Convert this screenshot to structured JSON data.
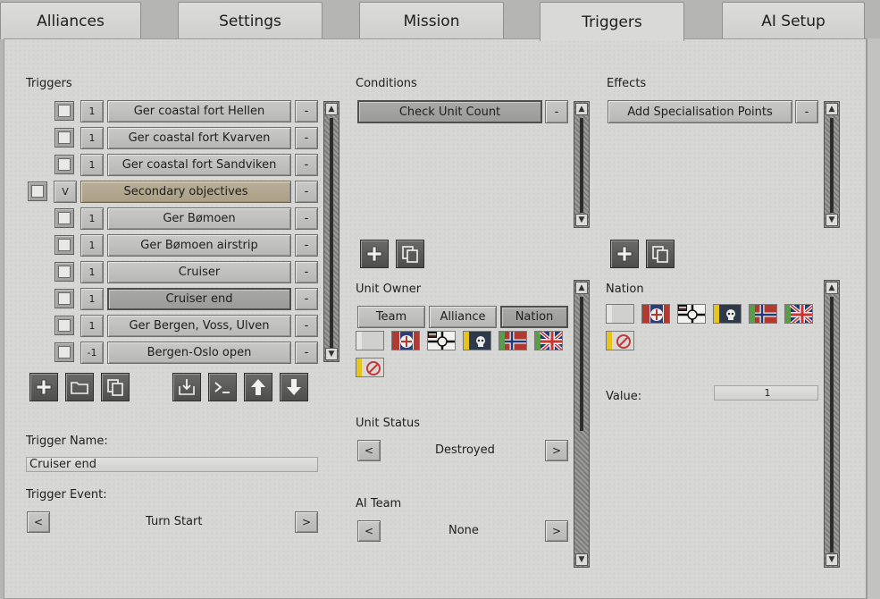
{
  "tabs": [
    "Alliances",
    "Settings",
    "Mission",
    "Triggers",
    "AI Setup"
  ],
  "triggers": {
    "title": "Triggers",
    "rows": [
      {
        "num": "1",
        "name": "Ger coastal fort Hellen",
        "remove": "-"
      },
      {
        "num": "1",
        "name": "Ger coastal fort Kvarven",
        "remove": "-"
      },
      {
        "num": "1",
        "name": "Ger coastal fort Sandviken",
        "remove": "-"
      },
      {
        "num": "V",
        "name": "Secondary objectives",
        "remove": "-"
      },
      {
        "num": "1",
        "name": "Ger Bømoen",
        "remove": "-"
      },
      {
        "num": "1",
        "name": "Ger Bømoen airstrip",
        "remove": "-"
      },
      {
        "num": "1",
        "name": "Cruiser",
        "remove": "-"
      },
      {
        "num": "1",
        "name": "Cruiser end",
        "remove": "-"
      },
      {
        "num": "1",
        "name": "Ger Bergen, Voss, Ulven",
        "remove": "-"
      },
      {
        "num": "-1",
        "name": "Bergen-Oslo open",
        "remove": "-"
      }
    ],
    "name_label": "Trigger Name:",
    "name_value": "Cruiser end",
    "event_label": "Trigger Event:",
    "event_value": "Turn Start",
    "prev": "<",
    "next": ">"
  },
  "conditions": {
    "title": "Conditions",
    "items": [
      {
        "name": "Check Unit Count",
        "remove": "-"
      }
    ],
    "owner_label": "Unit Owner",
    "owner_options": [
      "Team",
      "Alliance",
      "Nation"
    ],
    "status_label": "Unit Status",
    "status_value": "Destroyed",
    "ai_label": "AI Team",
    "ai_value": "None",
    "prev": "<",
    "next": ">"
  },
  "effects": {
    "title": "Effects",
    "items": [
      {
        "name": "Add Specialisation Points",
        "remove": "-"
      }
    ],
    "nation_label": "Nation",
    "value_label": "Value:",
    "value": "1"
  },
  "icons": {
    "add": "plus-icon",
    "folder": "folder-icon",
    "copy": "copy-icon",
    "import": "import-icon",
    "console": "console-icon",
    "up": "arrow-up-icon",
    "down": "arrow-down-icon"
  },
  "flags": [
    "white",
    "british-red",
    "german",
    "skull-yellow",
    "norway",
    "uk",
    "none-yellow"
  ]
}
